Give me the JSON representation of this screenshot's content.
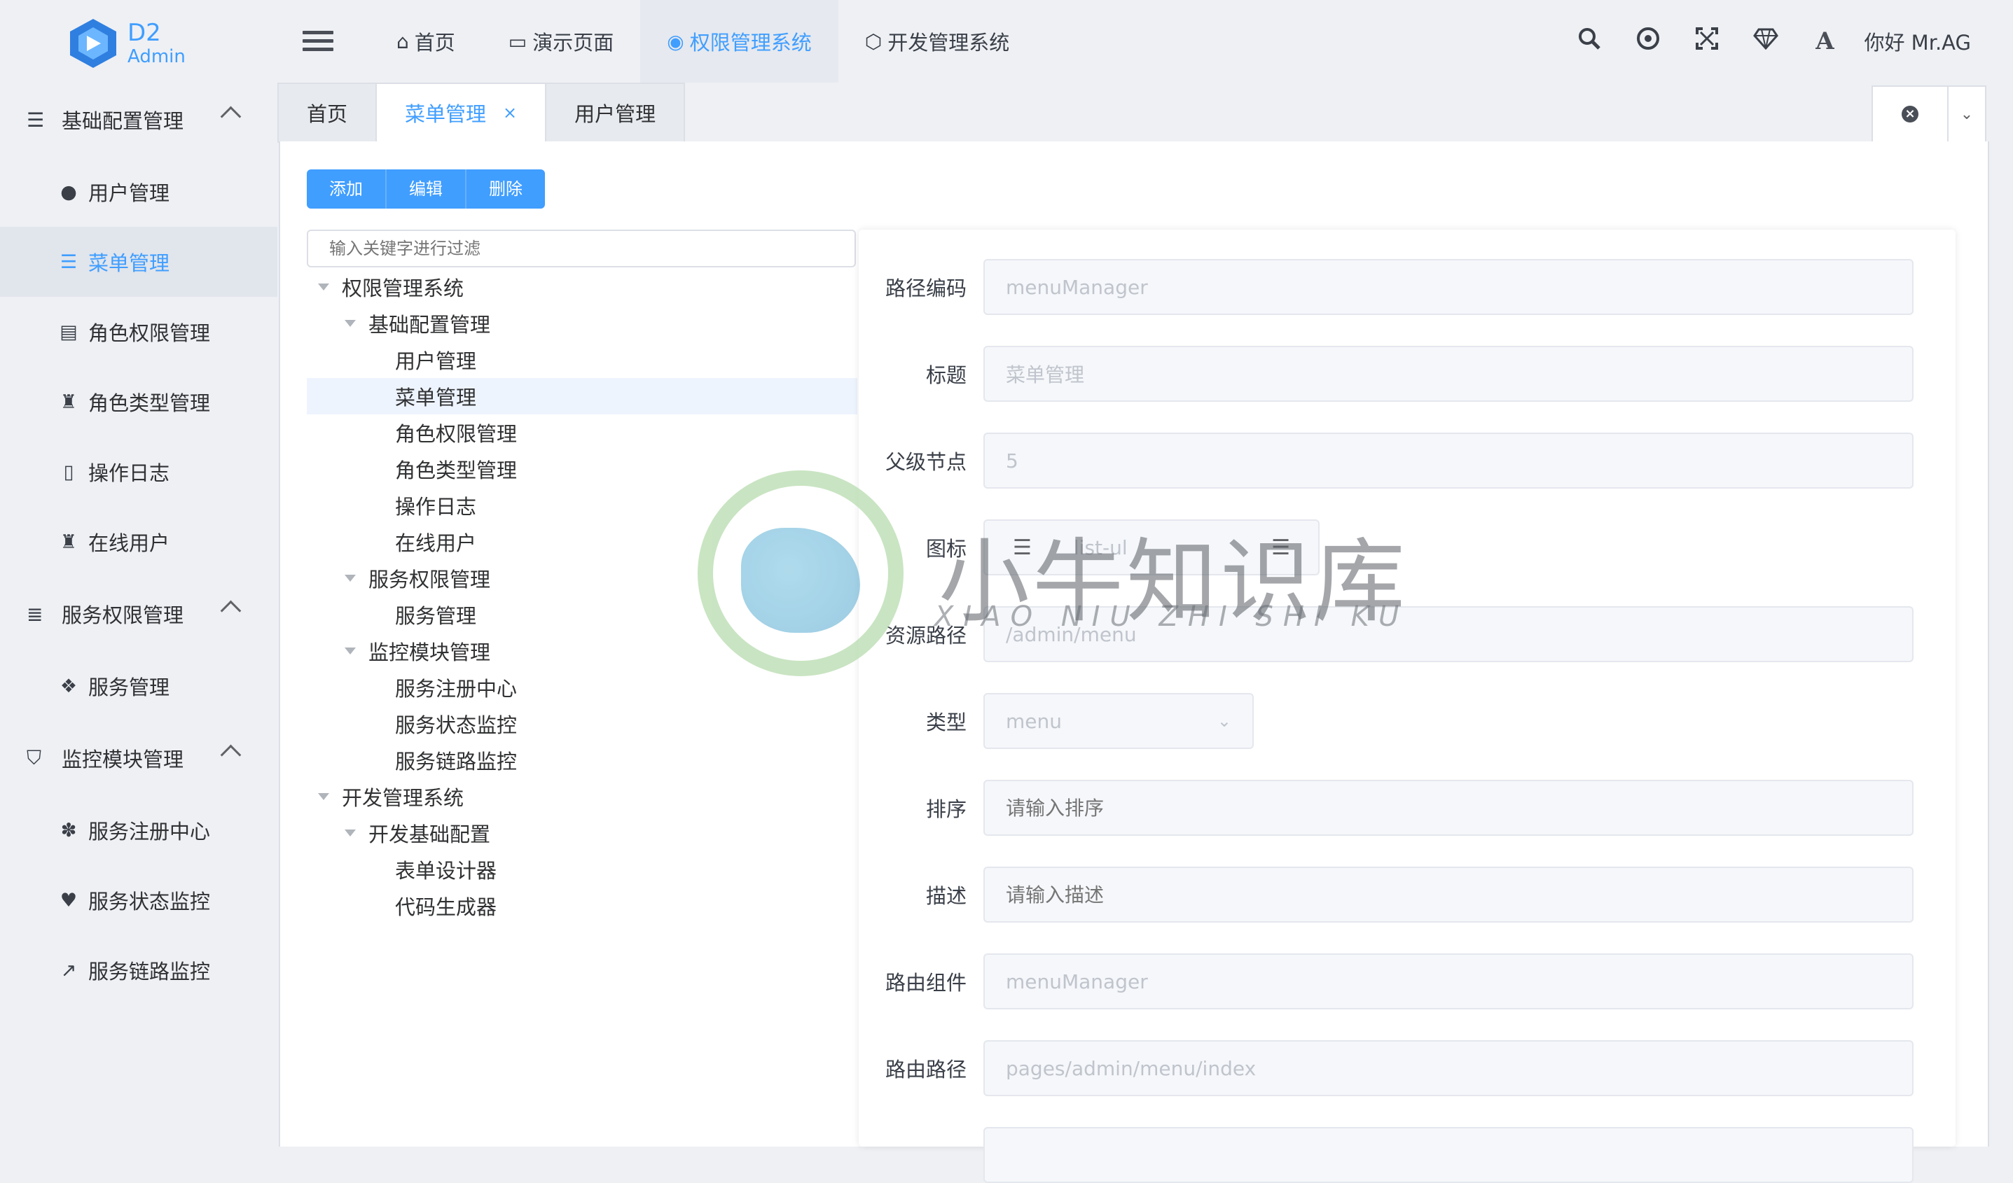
{
  "app": {
    "logo_d2": "D2",
    "logo_admin": "Admin"
  },
  "topmenu": [
    {
      "icon": "home-icon",
      "glyph": "⌂",
      "label": "首页"
    },
    {
      "icon": "folder-icon",
      "glyph": "▭",
      "label": "演示页面"
    },
    {
      "icon": "chrome-icon",
      "glyph": "◉",
      "label": "权限管理系统"
    },
    {
      "icon": "hexagon-icon",
      "glyph": "⬡",
      "label": "开发管理系统"
    }
  ],
  "topright": {
    "user": "你好 Mr.AG"
  },
  "sidebar": {
    "groups": [
      {
        "label": "基础配置管理",
        "items": [
          "用户管理",
          "菜单管理",
          "角色权限管理",
          "角色类型管理",
          "操作日志",
          "在线用户"
        ]
      },
      {
        "label": "服务权限管理",
        "items": [
          "服务管理"
        ]
      },
      {
        "label": "监控模块管理",
        "items": [
          "服务注册中心",
          "服务状态监控",
          "服务链路监控"
        ]
      }
    ]
  },
  "tabs": {
    "home": "首页",
    "menu": "菜单管理",
    "menu_close": "×",
    "user": "用户管理"
  },
  "toolbar": {
    "add": "添加",
    "edit": "编辑",
    "delete": "删除"
  },
  "filter": {
    "placeholder": "输入关键字进行过滤"
  },
  "tree": [
    {
      "label": "权限管理系统",
      "level": 0,
      "caret": true
    },
    {
      "label": "基础配置管理",
      "level": 1,
      "caret": true
    },
    {
      "label": "用户管理",
      "level": 2
    },
    {
      "label": "菜单管理",
      "level": 2,
      "selected": true
    },
    {
      "label": "角色权限管理",
      "level": 2
    },
    {
      "label": "角色类型管理",
      "level": 2
    },
    {
      "label": "操作日志",
      "level": 2
    },
    {
      "label": "在线用户",
      "level": 2
    },
    {
      "label": "服务权限管理",
      "level": 1,
      "caret": true
    },
    {
      "label": "服务管理",
      "level": 2
    },
    {
      "label": "监控模块管理",
      "level": 1,
      "caret": true
    },
    {
      "label": "服务注册中心",
      "level": 2
    },
    {
      "label": "服务状态监控",
      "level": 2
    },
    {
      "label": "服务链路监控",
      "level": 2
    },
    {
      "label": "开发管理系统",
      "level": 0,
      "caret": true
    },
    {
      "label": "开发基础配置",
      "level": 1,
      "caret": true
    },
    {
      "label": "表单设计器",
      "level": 2
    },
    {
      "label": "代码生成器",
      "level": 2
    }
  ],
  "form": {
    "path_code": {
      "label": "路径编码",
      "value": "menuManager"
    },
    "title": {
      "label": "标题",
      "value": "菜单管理"
    },
    "parent": {
      "label": "父级节点",
      "value": "5"
    },
    "icon": {
      "label": "图标",
      "value": "list-ul"
    },
    "resource": {
      "label": "资源路径",
      "value": "/admin/menu"
    },
    "type": {
      "label": "类型",
      "value": "menu"
    },
    "sort": {
      "label": "排序",
      "placeholder": "请输入排序"
    },
    "desc": {
      "label": "描述",
      "placeholder": "请输入描述"
    },
    "component": {
      "label": "路由组件",
      "value": "menuManager"
    },
    "route": {
      "label": "路由路径",
      "value": "pages/admin/menu/index"
    }
  },
  "watermark": {
    "text": "小牛知识库",
    "sub": "XIAO NIU ZHI SHI KU"
  },
  "colors": {
    "accent": "#409eff",
    "sidebar_bg": "#eef0f4",
    "active_bg": "#e1e5ec"
  }
}
